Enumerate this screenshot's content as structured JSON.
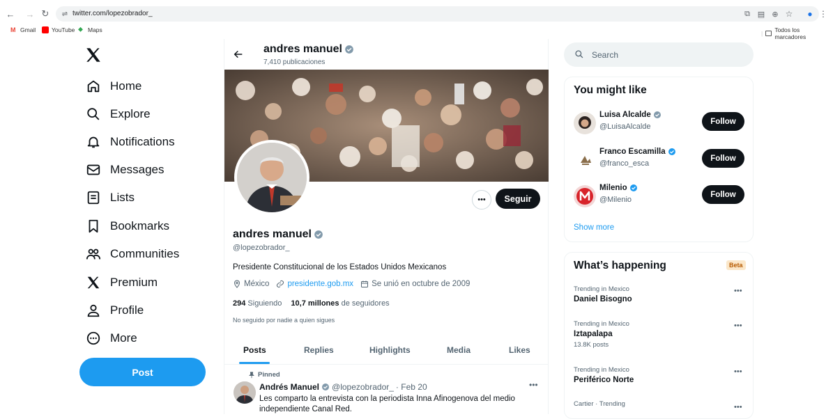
{
  "browser": {
    "url": "twitter.com/lopezobrador_",
    "bookmarks": [
      "Gmail",
      "YouTube",
      "Maps"
    ],
    "bookmarks_right": "Todos los marcadores"
  },
  "nav": {
    "items": [
      {
        "label": "Home",
        "icon": "home-icon"
      },
      {
        "label": "Explore",
        "icon": "search-icon"
      },
      {
        "label": "Notifications",
        "icon": "bell-icon"
      },
      {
        "label": "Messages",
        "icon": "envelope-icon"
      },
      {
        "label": "Lists",
        "icon": "list-icon"
      },
      {
        "label": "Bookmarks",
        "icon": "bookmark-icon"
      },
      {
        "label": "Communities",
        "icon": "people-icon"
      },
      {
        "label": "Premium",
        "icon": "x-logo-icon"
      },
      {
        "label": "Profile",
        "icon": "person-icon"
      },
      {
        "label": "More",
        "icon": "more-circle-icon"
      }
    ],
    "post_label": "Post"
  },
  "profile": {
    "header_name": "andres manuel",
    "posts_count": "7,410 publicaciones",
    "follow_label": "Seguir",
    "name": "andres manuel",
    "handle": "@lopezobrador_",
    "bio": "Presidente Constitucional de los Estados Unidos Mexicanos",
    "location": "México",
    "website": "presidente.gob.mx",
    "joined": "Se unió en octubre de 2009",
    "following_count": "294",
    "following_label": "Siguiendo",
    "followers_count": "10,7 millones",
    "followers_label": "de seguidores",
    "not_followed": "No seguido por nadie a quien sigues"
  },
  "tabs": [
    "Posts",
    "Replies",
    "Highlights",
    "Media",
    "Likes"
  ],
  "active_tab": "Posts",
  "pinned_tweet": {
    "pinned_label": "Pinned",
    "author": "Andrés Manuel",
    "handle": "@lopezobrador_",
    "date": "· Feb 20",
    "text": "Les comparto la entrevista con la periodista Inna Afinogenova del medio independiente Canal Red."
  },
  "search": {
    "placeholder": "Search"
  },
  "you_might_like": {
    "title": "You might like",
    "users": [
      {
        "name": "Luisa Alcalde",
        "handle": "@LuisaAlcalde",
        "button": "Follow"
      },
      {
        "name": "Franco Escamilla",
        "handle": "@franco_esca",
        "button": "Follow"
      },
      {
        "name": "Milenio",
        "handle": "@Milenio",
        "button": "Follow"
      }
    ],
    "show_more": "Show more"
  },
  "whats_happening": {
    "title": "What’s happening",
    "badge": "Beta",
    "trends": [
      {
        "context": "Trending in Mexico",
        "topic": "Daniel Bisogno",
        "count": ""
      },
      {
        "context": "Trending in Mexico",
        "topic": "Iztapalapa",
        "count": "13.8K posts"
      },
      {
        "context": "Trending in Mexico",
        "topic": "Periférico Norte",
        "count": ""
      },
      {
        "context": "Cartier · Trending",
        "topic": "",
        "count": ""
      }
    ]
  },
  "colors": {
    "accent": "#1d9bf0",
    "dark": "#0f1419",
    "muted": "#536471",
    "verified": "#829aab"
  }
}
